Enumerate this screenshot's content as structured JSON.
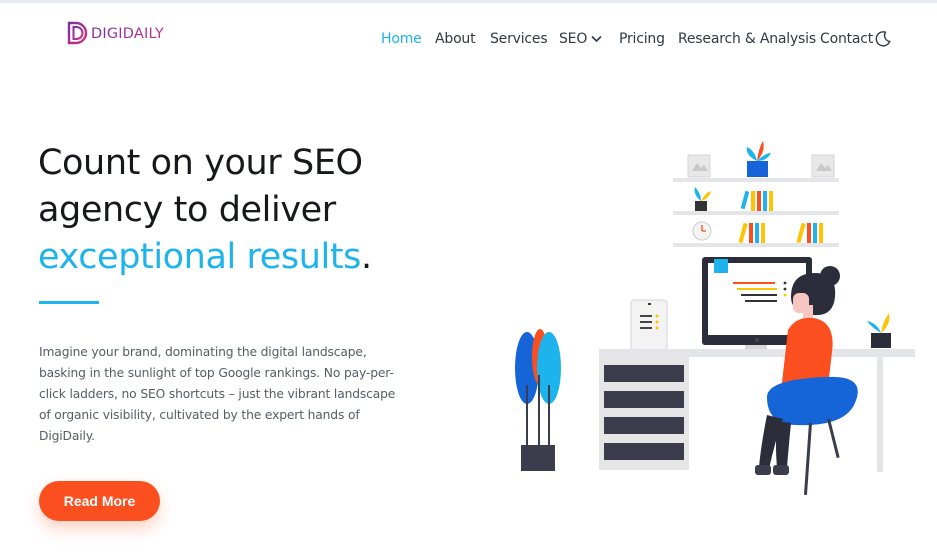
{
  "brand": {
    "logo_text": "DIGIDAILY",
    "logo_letter": "D",
    "colors": {
      "primary": "#1db4ee",
      "cta": "#fc4f1f",
      "logo": "#8e2da0"
    }
  },
  "nav": {
    "items": [
      {
        "label": "Home",
        "active": true
      },
      {
        "label": "About"
      },
      {
        "label": "Services"
      },
      {
        "label": "SEO"
      },
      {
        "label": "Pricing"
      },
      {
        "label": "Research & Analysis"
      },
      {
        "label": "Contact"
      }
    ],
    "seo_icon": "chevron-down-icon",
    "theme_icon": "moon-icon"
  },
  "hero": {
    "line1": "Count on your SEO",
    "line2": "agency to deliver",
    "highlight": "exceptional results",
    "period": ".",
    "body": "Imagine your brand, dominating the digital landscape, basking in the sunlight of top Google rankings. No pay-per-click ladders, no SEO shortcuts – just the vibrant landscape of organic visibility, cultivated by the expert hands of DigiDaily.",
    "cta_label": "Read More",
    "illustration": "person-working-at-desk-illustration"
  }
}
